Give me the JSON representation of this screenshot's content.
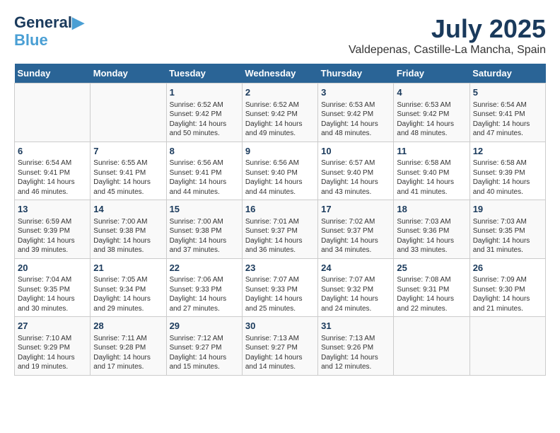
{
  "header": {
    "logo_line1": "General",
    "logo_line2": "Blue",
    "main_title": "July 2025",
    "subtitle": "Valdepenas, Castille-La Mancha, Spain"
  },
  "columns": [
    "Sunday",
    "Monday",
    "Tuesday",
    "Wednesday",
    "Thursday",
    "Friday",
    "Saturday"
  ],
  "weeks": [
    [
      {
        "day": "",
        "detail": ""
      },
      {
        "day": "",
        "detail": ""
      },
      {
        "day": "1",
        "detail": "Sunrise: 6:52 AM\nSunset: 9:42 PM\nDaylight: 14 hours and 50 minutes."
      },
      {
        "day": "2",
        "detail": "Sunrise: 6:52 AM\nSunset: 9:42 PM\nDaylight: 14 hours and 49 minutes."
      },
      {
        "day": "3",
        "detail": "Sunrise: 6:53 AM\nSunset: 9:42 PM\nDaylight: 14 hours and 48 minutes."
      },
      {
        "day": "4",
        "detail": "Sunrise: 6:53 AM\nSunset: 9:42 PM\nDaylight: 14 hours and 48 minutes."
      },
      {
        "day": "5",
        "detail": "Sunrise: 6:54 AM\nSunset: 9:41 PM\nDaylight: 14 hours and 47 minutes."
      }
    ],
    [
      {
        "day": "6",
        "detail": "Sunrise: 6:54 AM\nSunset: 9:41 PM\nDaylight: 14 hours and 46 minutes."
      },
      {
        "day": "7",
        "detail": "Sunrise: 6:55 AM\nSunset: 9:41 PM\nDaylight: 14 hours and 45 minutes."
      },
      {
        "day": "8",
        "detail": "Sunrise: 6:56 AM\nSunset: 9:41 PM\nDaylight: 14 hours and 44 minutes."
      },
      {
        "day": "9",
        "detail": "Sunrise: 6:56 AM\nSunset: 9:40 PM\nDaylight: 14 hours and 44 minutes."
      },
      {
        "day": "10",
        "detail": "Sunrise: 6:57 AM\nSunset: 9:40 PM\nDaylight: 14 hours and 43 minutes."
      },
      {
        "day": "11",
        "detail": "Sunrise: 6:58 AM\nSunset: 9:40 PM\nDaylight: 14 hours and 41 minutes."
      },
      {
        "day": "12",
        "detail": "Sunrise: 6:58 AM\nSunset: 9:39 PM\nDaylight: 14 hours and 40 minutes."
      }
    ],
    [
      {
        "day": "13",
        "detail": "Sunrise: 6:59 AM\nSunset: 9:39 PM\nDaylight: 14 hours and 39 minutes."
      },
      {
        "day": "14",
        "detail": "Sunrise: 7:00 AM\nSunset: 9:38 PM\nDaylight: 14 hours and 38 minutes."
      },
      {
        "day": "15",
        "detail": "Sunrise: 7:00 AM\nSunset: 9:38 PM\nDaylight: 14 hours and 37 minutes."
      },
      {
        "day": "16",
        "detail": "Sunrise: 7:01 AM\nSunset: 9:37 PM\nDaylight: 14 hours and 36 minutes."
      },
      {
        "day": "17",
        "detail": "Sunrise: 7:02 AM\nSunset: 9:37 PM\nDaylight: 14 hours and 34 minutes."
      },
      {
        "day": "18",
        "detail": "Sunrise: 7:03 AM\nSunset: 9:36 PM\nDaylight: 14 hours and 33 minutes."
      },
      {
        "day": "19",
        "detail": "Sunrise: 7:03 AM\nSunset: 9:35 PM\nDaylight: 14 hours and 31 minutes."
      }
    ],
    [
      {
        "day": "20",
        "detail": "Sunrise: 7:04 AM\nSunset: 9:35 PM\nDaylight: 14 hours and 30 minutes."
      },
      {
        "day": "21",
        "detail": "Sunrise: 7:05 AM\nSunset: 9:34 PM\nDaylight: 14 hours and 29 minutes."
      },
      {
        "day": "22",
        "detail": "Sunrise: 7:06 AM\nSunset: 9:33 PM\nDaylight: 14 hours and 27 minutes."
      },
      {
        "day": "23",
        "detail": "Sunrise: 7:07 AM\nSunset: 9:33 PM\nDaylight: 14 hours and 25 minutes."
      },
      {
        "day": "24",
        "detail": "Sunrise: 7:07 AM\nSunset: 9:32 PM\nDaylight: 14 hours and 24 minutes."
      },
      {
        "day": "25",
        "detail": "Sunrise: 7:08 AM\nSunset: 9:31 PM\nDaylight: 14 hours and 22 minutes."
      },
      {
        "day": "26",
        "detail": "Sunrise: 7:09 AM\nSunset: 9:30 PM\nDaylight: 14 hours and 21 minutes."
      }
    ],
    [
      {
        "day": "27",
        "detail": "Sunrise: 7:10 AM\nSunset: 9:29 PM\nDaylight: 14 hours and 19 minutes."
      },
      {
        "day": "28",
        "detail": "Sunrise: 7:11 AM\nSunset: 9:28 PM\nDaylight: 14 hours and 17 minutes."
      },
      {
        "day": "29",
        "detail": "Sunrise: 7:12 AM\nSunset: 9:27 PM\nDaylight: 14 hours and 15 minutes."
      },
      {
        "day": "30",
        "detail": "Sunrise: 7:13 AM\nSunset: 9:27 PM\nDaylight: 14 hours and 14 minutes."
      },
      {
        "day": "31",
        "detail": "Sunrise: 7:13 AM\nSunset: 9:26 PM\nDaylight: 14 hours and 12 minutes."
      },
      {
        "day": "",
        "detail": ""
      },
      {
        "day": "",
        "detail": ""
      }
    ]
  ]
}
